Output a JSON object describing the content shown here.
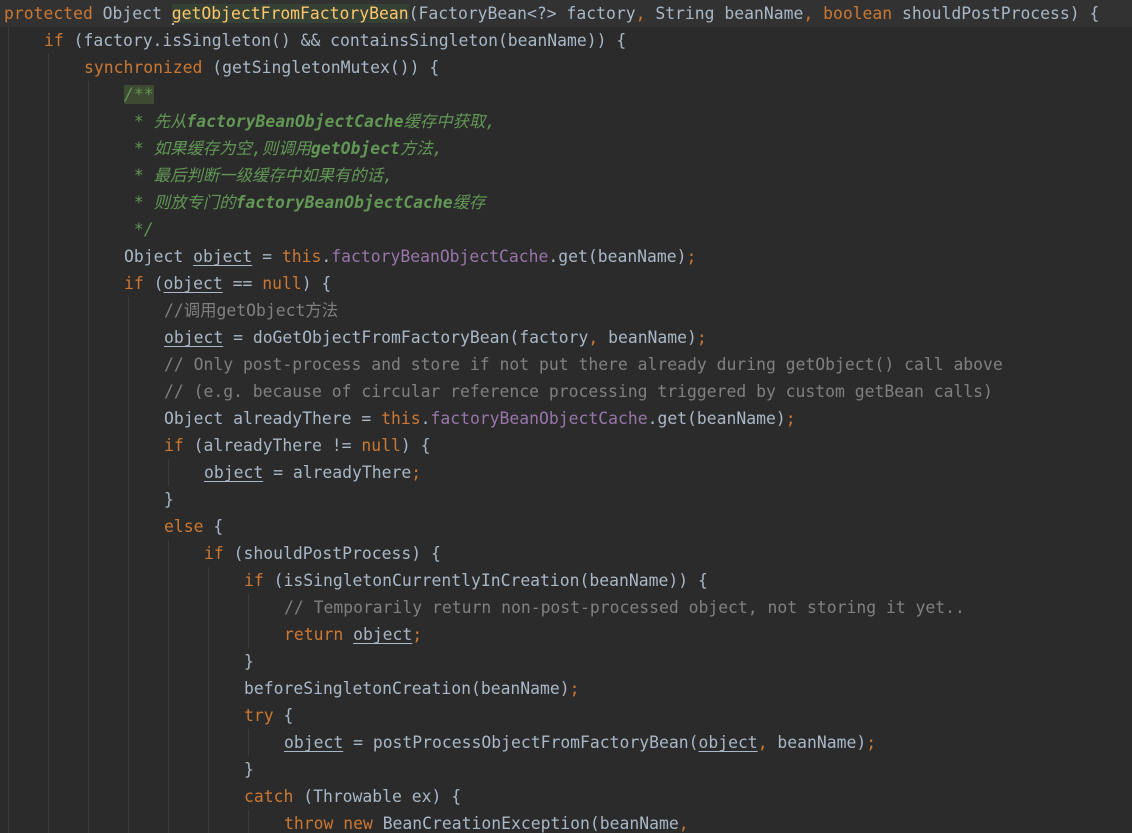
{
  "editor": {
    "theme": "darcula",
    "colors": {
      "background": "#2b2b2b",
      "text": "#a9b7c6",
      "keyword": "#cc7832",
      "method_declaration": "#ffc66d",
      "field": "#9876aa",
      "comment": "#808080",
      "doc_comment": "#629755"
    },
    "lines": [
      {
        "indent": 0,
        "current": true,
        "tokens": [
          [
            "kw",
            "protected"
          ],
          [
            "t",
            " Object "
          ],
          [
            "caret",
            ""
          ],
          [
            "fn hl",
            "getObjectFromFactoryBean"
          ],
          [
            "t",
            "(FactoryBean<?> factory"
          ],
          [
            "kw",
            ","
          ],
          [
            "t",
            " String beanName"
          ],
          [
            "kw",
            ", boolean"
          ],
          [
            "t",
            " shouldPostProcess) {"
          ]
        ]
      },
      {
        "indent": 1,
        "tokens": [
          [
            "kw",
            "if"
          ],
          [
            "t",
            " (factory.isSingleton() && containsSingleton(beanName)) {"
          ]
        ]
      },
      {
        "indent": 2,
        "tokens": [
          [
            "kw",
            "synchronized"
          ],
          [
            "t",
            " (getSingletonMutex()) {"
          ]
        ]
      },
      {
        "indent": 3,
        "tokens": [
          [
            "doc-open",
            "/**"
          ]
        ]
      },
      {
        "indent": 3,
        "tokens": [
          [
            "doc",
            " * 先从"
          ],
          [
            "doc-tag",
            "factoryBeanObjectCache"
          ],
          [
            "doc",
            "缓存中获取,"
          ]
        ]
      },
      {
        "indent": 3,
        "tokens": [
          [
            "doc",
            " * 如果缓存为空,则调用"
          ],
          [
            "doc-tag",
            "getObject"
          ],
          [
            "doc",
            "方法,"
          ]
        ]
      },
      {
        "indent": 3,
        "tokens": [
          [
            "doc",
            " * 最后判断一级缓存中如果有的话,"
          ]
        ]
      },
      {
        "indent": 3,
        "tokens": [
          [
            "doc",
            " * 则放专门的"
          ],
          [
            "doc-tag",
            "factoryBeanObjectCache"
          ],
          [
            "doc",
            "缓存"
          ]
        ]
      },
      {
        "indent": 3,
        "tokens": [
          [
            "doc",
            " */"
          ]
        ]
      },
      {
        "indent": 3,
        "tokens": [
          [
            "t",
            "Object "
          ],
          [
            "ul",
            "object"
          ],
          [
            "t",
            " = "
          ],
          [
            "kw",
            "this"
          ],
          [
            "t",
            "."
          ],
          [
            "field",
            "factoryBeanObjectCache"
          ],
          [
            "t",
            ".get(beanName)"
          ],
          [
            "kw",
            ";"
          ]
        ]
      },
      {
        "indent": 3,
        "tokens": [
          [
            "kw",
            "if"
          ],
          [
            "t",
            " ("
          ],
          [
            "ul",
            "object"
          ],
          [
            "t",
            " == "
          ],
          [
            "kw",
            "null"
          ],
          [
            "t",
            ") {"
          ]
        ]
      },
      {
        "indent": 4,
        "tokens": [
          [
            "cmt",
            "//调用getObject方法"
          ]
        ]
      },
      {
        "indent": 4,
        "tokens": [
          [
            "ul",
            "object"
          ],
          [
            "t",
            " = doGetObjectFromFactoryBean(factory"
          ],
          [
            "kw",
            ","
          ],
          [
            "t",
            " beanName)"
          ],
          [
            "kw",
            ";"
          ]
        ]
      },
      {
        "indent": 4,
        "tokens": [
          [
            "cmt",
            "// Only post-process and store if not put there already during getObject() call above"
          ]
        ]
      },
      {
        "indent": 4,
        "tokens": [
          [
            "cmt",
            "// (e.g. because of circular reference processing triggered by custom getBean calls)"
          ]
        ]
      },
      {
        "indent": 4,
        "tokens": [
          [
            "t",
            "Object alreadyThere = "
          ],
          [
            "kw",
            "this"
          ],
          [
            "t",
            "."
          ],
          [
            "field",
            "factoryBeanObjectCache"
          ],
          [
            "t",
            ".get(beanName)"
          ],
          [
            "kw",
            ";"
          ]
        ]
      },
      {
        "indent": 4,
        "tokens": [
          [
            "kw",
            "if"
          ],
          [
            "t",
            " (alreadyThere != "
          ],
          [
            "kw",
            "null"
          ],
          [
            "t",
            ") {"
          ]
        ]
      },
      {
        "indent": 5,
        "tokens": [
          [
            "ul",
            "object"
          ],
          [
            "t",
            " = alreadyThere"
          ],
          [
            "kw",
            ";"
          ]
        ]
      },
      {
        "indent": 4,
        "tokens": [
          [
            "t",
            "}"
          ]
        ]
      },
      {
        "indent": 4,
        "tokens": [
          [
            "kw",
            "else"
          ],
          [
            "t",
            " {"
          ]
        ]
      },
      {
        "indent": 5,
        "tokens": [
          [
            "kw",
            "if"
          ],
          [
            "t",
            " (shouldPostProcess) {"
          ]
        ]
      },
      {
        "indent": 6,
        "tokens": [
          [
            "kw",
            "if"
          ],
          [
            "t",
            " (isSingletonCurrentlyInCreation(beanName)) {"
          ]
        ]
      },
      {
        "indent": 7,
        "tokens": [
          [
            "cmt",
            "// Temporarily return non-post-processed object, not storing it yet.."
          ]
        ]
      },
      {
        "indent": 7,
        "tokens": [
          [
            "kw",
            "return "
          ],
          [
            "ul",
            "object"
          ],
          [
            "kw",
            ";"
          ]
        ]
      },
      {
        "indent": 6,
        "tokens": [
          [
            "t",
            "}"
          ]
        ]
      },
      {
        "indent": 6,
        "tokens": [
          [
            "t",
            "beforeSingletonCreation(beanName)"
          ],
          [
            "kw",
            ";"
          ]
        ]
      },
      {
        "indent": 6,
        "tokens": [
          [
            "kw",
            "try"
          ],
          [
            "t",
            " {"
          ]
        ]
      },
      {
        "indent": 7,
        "tokens": [
          [
            "ul",
            "object"
          ],
          [
            "t",
            " = postProcessObjectFromFactoryBean("
          ],
          [
            "ul",
            "object"
          ],
          [
            "kw",
            ","
          ],
          [
            "t",
            " beanName)"
          ],
          [
            "kw",
            ";"
          ]
        ]
      },
      {
        "indent": 6,
        "tokens": [
          [
            "t",
            "}"
          ]
        ]
      },
      {
        "indent": 6,
        "tokens": [
          [
            "kw",
            "catch"
          ],
          [
            "t",
            " (Throwable ex) {"
          ]
        ]
      },
      {
        "indent": 7,
        "tokens": [
          [
            "kw",
            "throw new "
          ],
          [
            "t",
            "BeanCreationException(beanName"
          ],
          [
            "kw",
            ","
          ]
        ]
      }
    ]
  }
}
